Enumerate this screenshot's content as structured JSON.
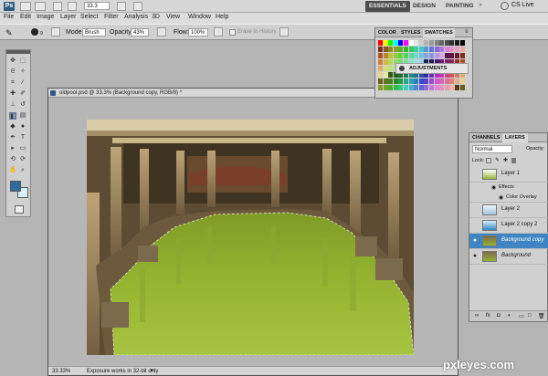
{
  "app": {
    "logo": "Ps",
    "zoom": "33.3",
    "workspace_buttons": [
      "ESSENTIALS",
      "DESIGN",
      "PAINTING"
    ],
    "cs_live": "CS Live"
  },
  "menu": {
    "items": [
      "File",
      "Edit",
      "Image",
      "Layer",
      "Select",
      "Filter",
      "Analysis",
      "3D",
      "View",
      "Window",
      "Help"
    ]
  },
  "options": {
    "mode_label": "Mode:",
    "mode_value": "Brush",
    "opacity_label": "Opacity:",
    "opacity_value": "43%",
    "flow_label": "Flow:",
    "flow_value": "100%",
    "erase_history": "Erase to History"
  },
  "document": {
    "tab_title": "oldpool.psd @ 33.3% (Background copy, RGB/8) *",
    "zoom_status": "33.33%",
    "status_text": "Exposure works in 32-bit only"
  },
  "swatch_panel": {
    "tabs": [
      "COLOR",
      "STYLES",
      "SWATCHES"
    ],
    "active_tab": "SWATCHES",
    "adjustments": "ADJUSTMENTS"
  },
  "layers_panel": {
    "tabs": [
      "CHANNELS",
      "LAYERS"
    ],
    "active_tab": "LAYERS",
    "blend_mode": "Normal",
    "opacity_label": "Opacity:",
    "lock_label": "Lock:",
    "layers": [
      {
        "name": "Layer 1",
        "visible": false,
        "selected": false,
        "thumb": "green-gradient"
      },
      {
        "name": "Effects",
        "visible": false,
        "selected": false,
        "thumb": "none"
      },
      {
        "name": "Color Overlay",
        "visible": false,
        "selected": false,
        "thumb": "none"
      },
      {
        "name": "Layer 2",
        "visible": false,
        "selected": false,
        "thumb": "sky"
      },
      {
        "name": "Layer 2 copy 2",
        "visible": false,
        "selected": false,
        "thumb": "blue"
      },
      {
        "name": "Background copy",
        "visible": true,
        "selected": true,
        "thumb": "pool"
      },
      {
        "name": "Background",
        "visible": true,
        "selected": false,
        "thumb": "pool"
      }
    ]
  },
  "watermark": "pxleyes.com",
  "colors": {
    "foreground": "#2a6d9a",
    "background": "#d8f0fa",
    "selection": "#3f85c4",
    "pool_water": "#8fae2e"
  }
}
